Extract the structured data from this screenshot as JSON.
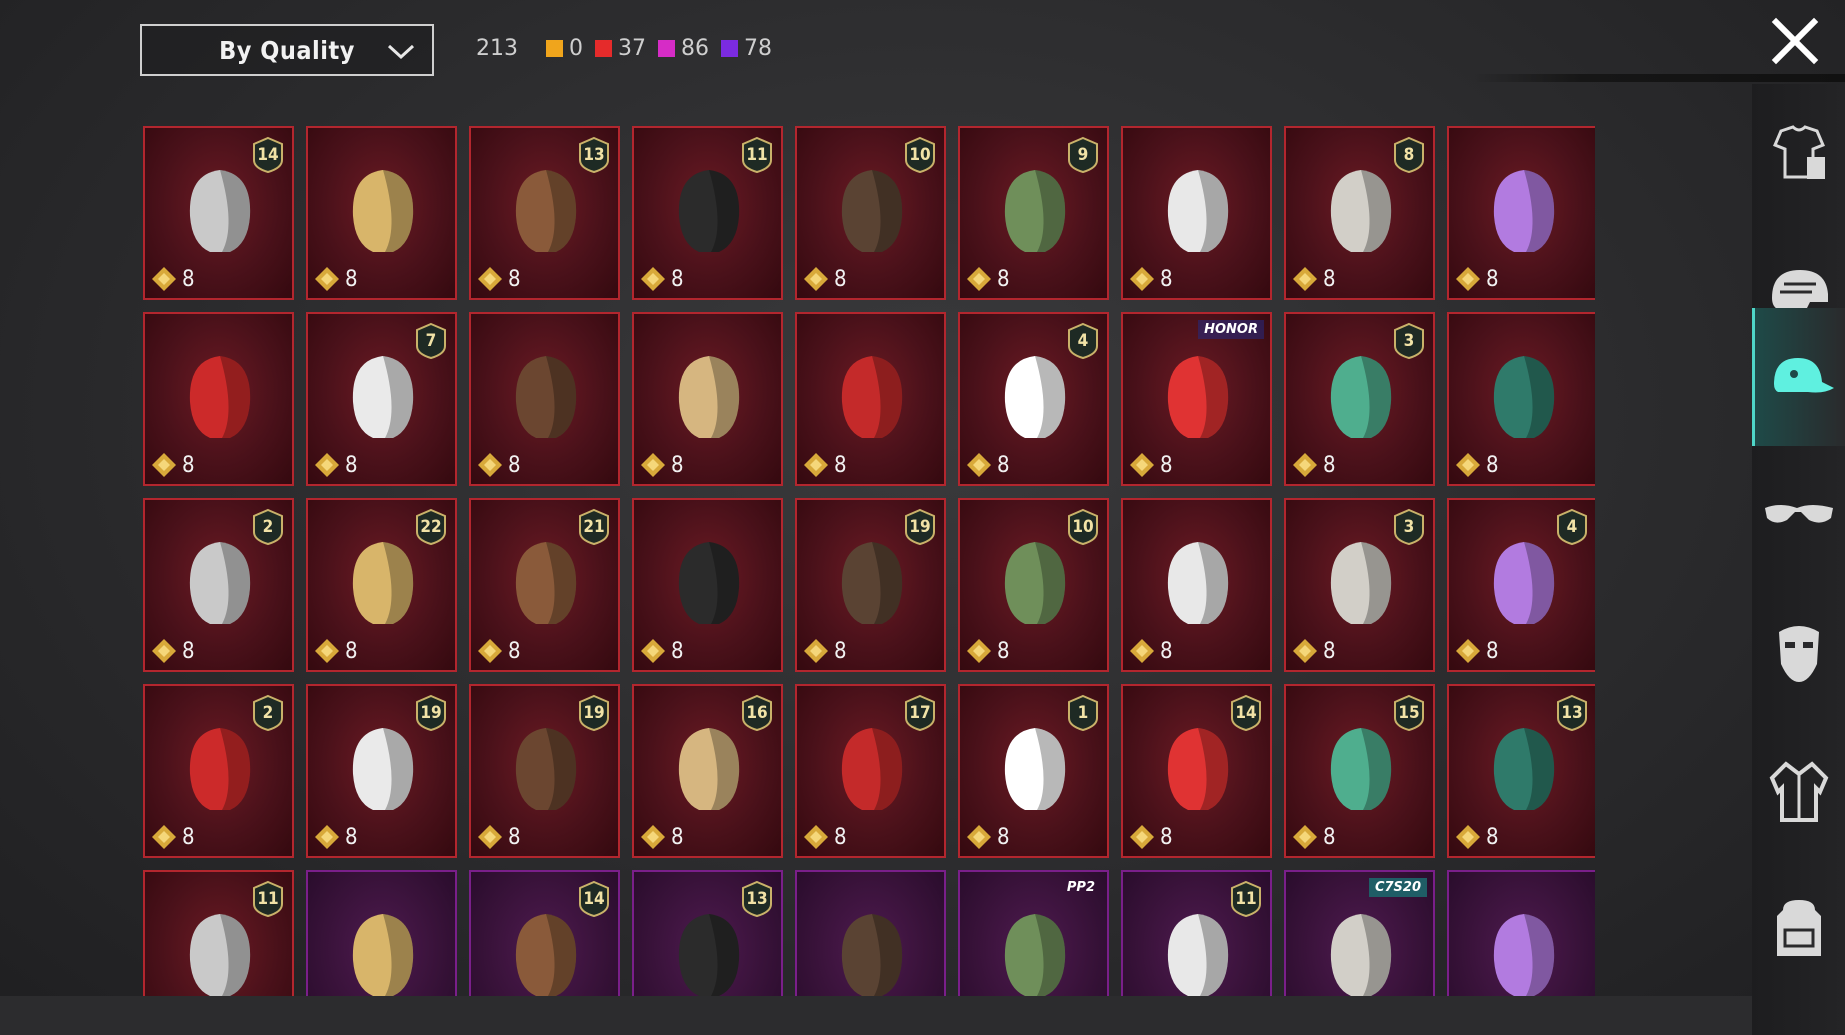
{
  "sort": {
    "label": "By Quality"
  },
  "counts": {
    "total": "213",
    "items": [
      {
        "value": "0",
        "color": "#f0a51c"
      },
      {
        "value": "37",
        "color": "#e52b2b"
      },
      {
        "value": "86",
        "color": "#d62cc6"
      },
      {
        "value": "78",
        "color": "#7b2be0"
      }
    ]
  },
  "sidebar": {
    "items": [
      {
        "icon": "outfit-icon",
        "active": false
      },
      {
        "icon": "helmet-icon",
        "active": false
      },
      {
        "icon": "hat-icon",
        "active": true
      },
      {
        "icon": "glasses-icon",
        "active": false
      },
      {
        "icon": "mask-icon",
        "active": false
      },
      {
        "icon": "jacket-icon",
        "active": false
      },
      {
        "icon": "backpack-icon",
        "active": false
      }
    ]
  },
  "items": [
    {
      "art": "fox-hood-helmet",
      "level": "14",
      "price": "8",
      "quality": "red"
    },
    {
      "art": "golden-hair",
      "level": "",
      "price": "8",
      "quality": "red"
    },
    {
      "art": "floral-hat",
      "level": "13",
      "price": "8",
      "quality": "red"
    },
    {
      "art": "black-helmet",
      "level": "11",
      "price": "8",
      "quality": "red"
    },
    {
      "art": "dark-hair",
      "level": "10",
      "price": "8",
      "quality": "red"
    },
    {
      "art": "zombie-head",
      "level": "9",
      "price": "8",
      "quality": "red"
    },
    {
      "art": "white-cowboy-hat",
      "level": "",
      "price": "8",
      "quality": "red"
    },
    {
      "art": "silver-hair",
      "level": "8",
      "price": "8",
      "quality": "red"
    },
    {
      "art": "purple-ponytail",
      "level": "",
      "price": "8",
      "quality": "red"
    },
    {
      "art": "red-oni-mask",
      "level": "",
      "price": "8",
      "quality": "red"
    },
    {
      "art": "white-long-hair",
      "level": "7",
      "price": "8",
      "quality": "red"
    },
    {
      "art": "brown-cat-hair",
      "level": "",
      "price": "8",
      "quality": "red"
    },
    {
      "art": "blonde-long-hair",
      "level": "",
      "price": "8",
      "quality": "red"
    },
    {
      "art": "red-helmet",
      "level": "",
      "price": "8",
      "quality": "red"
    },
    {
      "art": "snowman-tophat",
      "level": "4",
      "price": "8",
      "quality": "red"
    },
    {
      "art": "red-hair-hat",
      "level": "HONOR",
      "price": "8",
      "quality": "red",
      "tag": true
    },
    {
      "art": "joker-head",
      "level": "3",
      "price": "8",
      "quality": "red"
    },
    {
      "art": "teal-dragon-helm",
      "level": "",
      "price": "8",
      "quality": "red"
    },
    {
      "art": "cyan-bucket-hat",
      "level": "2",
      "price": "8",
      "quality": "red"
    },
    {
      "art": "gold-pharaoh-helm",
      "level": "22",
      "price": "8",
      "quality": "red"
    },
    {
      "art": "silver-demon-mask",
      "level": "21",
      "price": "8",
      "quality": "red"
    },
    {
      "art": "red-horned-mask",
      "level": "",
      "price": "8",
      "quality": "red"
    },
    {
      "art": "black-tactical-helm",
      "level": "19",
      "price": "8",
      "quality": "red"
    },
    {
      "art": "chef-crow-hat",
      "level": "10",
      "price": "8",
      "quality": "red"
    },
    {
      "art": "dark-knight-helm",
      "level": "",
      "price": "8",
      "quality": "red"
    },
    {
      "art": "fries-head",
      "level": "3",
      "price": "8",
      "quality": "red"
    },
    {
      "art": "gold-purple-helm",
      "level": "4",
      "price": "8",
      "quality": "red"
    },
    {
      "art": "blue-samurai-helm",
      "level": "2",
      "price": "8",
      "quality": "red"
    },
    {
      "art": "red-samurai-mask",
      "level": "19",
      "price": "8",
      "quality": "red"
    },
    {
      "art": "pink-elf-mask",
      "level": "19",
      "price": "8",
      "quality": "red"
    },
    {
      "art": "purple-visor-helm",
      "level": "16",
      "price": "8",
      "quality": "red"
    },
    {
      "art": "gold-flame-helm",
      "level": "17",
      "price": "8",
      "quality": "red"
    },
    {
      "art": "cosmic-helm",
      "level": "1",
      "price": "8",
      "quality": "red"
    },
    {
      "art": "purple-flower-hat",
      "level": "14",
      "price": "8",
      "quality": "red"
    },
    {
      "art": "bronze-plume-helm",
      "level": "15",
      "price": "8",
      "quality": "red"
    },
    {
      "art": "blue-red-robot-helm",
      "level": "13",
      "price": "8",
      "quality": "red"
    },
    {
      "art": "gold-sci-fi-helm",
      "level": "11",
      "price": "",
      "quality": "red"
    },
    {
      "art": "burgundy-hair",
      "level": "",
      "price": "",
      "quality": "purple"
    },
    {
      "art": "blonde-flower-hair",
      "level": "14",
      "price": "",
      "quality": "purple"
    },
    {
      "art": "goggles-hat",
      "level": "13",
      "price": "",
      "quality": "purple"
    },
    {
      "art": "white-hood",
      "level": "",
      "price": "",
      "quality": "purple"
    },
    {
      "art": "panda-head",
      "level": "PP2",
      "price": "",
      "quality": "purple",
      "tag": true
    },
    {
      "art": "flower-crown-hair",
      "level": "11",
      "price": "",
      "quality": "purple"
    },
    {
      "art": "green-hair",
      "level": "C7S20",
      "price": "",
      "quality": "purple",
      "tag": true
    },
    {
      "art": "pumpkin-head",
      "level": "",
      "price": "",
      "quality": "purple"
    }
  ]
}
